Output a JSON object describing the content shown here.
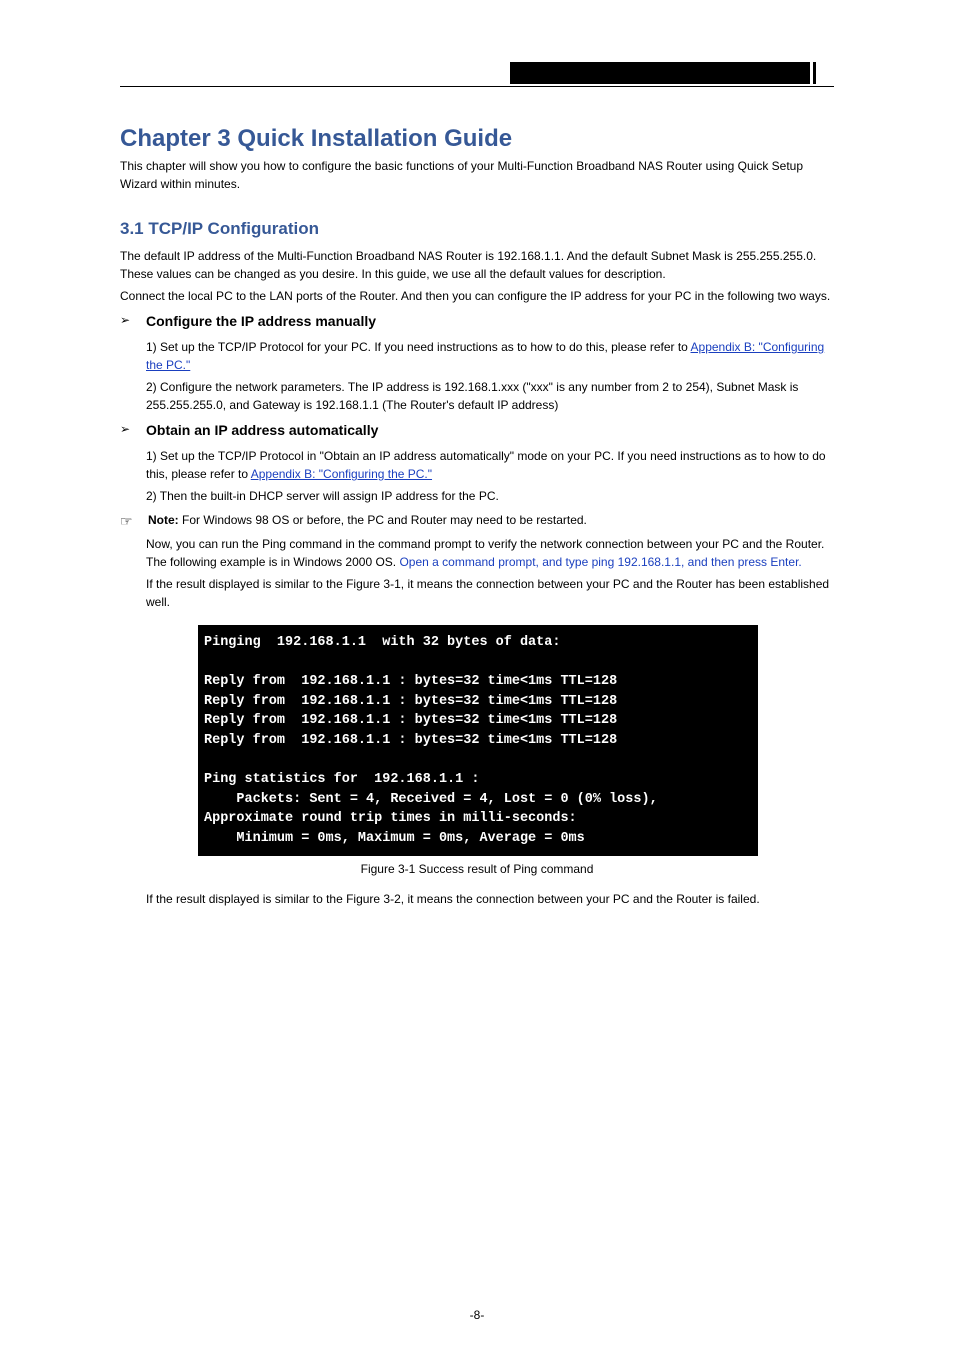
{
  "chapter_title": "Chapter 3 Quick Installation Guide",
  "intro": "This chapter will show you how to configure the basic functions of your Multi-Function Broadband NAS Router using Quick Setup Wizard within minutes.",
  "sections": {
    "tcp": {
      "title": "3.1 TCP/IP Configuration",
      "para1": "The default IP address of the Multi-Function Broadband NAS Router is 192.168.1.1. And the default Subnet Mask is 255.255.255.0. These values can be changed as you desire. In this guide, we use all the default values for description.",
      "para2": "Connect the local PC to the LAN ports of the Router. And then you can configure the IP address for your PC in the following two ways.",
      "bullets": [
        {
          "head": "Configure the IP address manually",
          "b1": "1)  Set up the TCP/IP Protocol for your PC. If you need instructions as to how to do this, please refer to ",
          "b1_link": "Appendix B: \"Configuring the PC.\"",
          "b2": "2)  Configure the network parameters. The IP address is 192.168.1.xxx (\"xxx\" is any number from 2 to 254), Subnet Mask is 255.255.255.0, and Gateway is 192.168.1.1 (The Router's default IP address)"
        },
        {
          "head": "Obtain an IP address automatically",
          "b1": "1)  Set up the TCP/IP Protocol in \"Obtain an IP address automatically\" mode on your PC. If you need instructions as to how to do this, please refer to ",
          "b1_link": "Appendix B: \"Configuring the PC.\"",
          "b2": "2)  Then the built-in DHCP server will assign IP address for the PC."
        }
      ],
      "note": {
        "label": "Note:",
        "body": "For Windows 98 OS or before, the PC and Router may need to be restarted."
      },
      "after_note_p1_a": "Now, you can run the Ping command in the command prompt to verify the network connection between your PC and the Router. The following example is in Windows 2000 OS.",
      "after_note_p1_b": "Open a command prompt, and type ping 192.168.1.1, and then press Enter.",
      "after_note_p2": "If the result displayed is similar to the Figure 3-1, it means the connection between your PC and the Router has been established well.",
      "terminal": {
        "l1": "Pinging  192.168.1.1  with 32 bytes of data:",
        "l2": "Reply from  192.168.1.1 : bytes=32 time<1ms TTL=128",
        "l3": "Reply from  192.168.1.1 : bytes=32 time<1ms TTL=128",
        "l4": "Reply from  192.168.1.1 : bytes=32 time<1ms TTL=128",
        "l5": "Reply from  192.168.1.1 : bytes=32 time<1ms TTL=128",
        "l6": "Ping statistics for  192.168.1.1 :",
        "l7": "    Packets: Sent = 4, Received = 4, Lost = 0 (0% loss),",
        "l8": "Approximate round trip times in milli-seconds:",
        "l9": "    Minimum = 0ms, Maximum = 0ms, Average = 0ms"
      },
      "figcap": "Figure 3-1  Success result of Ping command",
      "after_fig": "If the result displayed is similar to the Figure 3-2, it means the connection between your PC and the Router is failed."
    }
  },
  "page_number": "-8-"
}
